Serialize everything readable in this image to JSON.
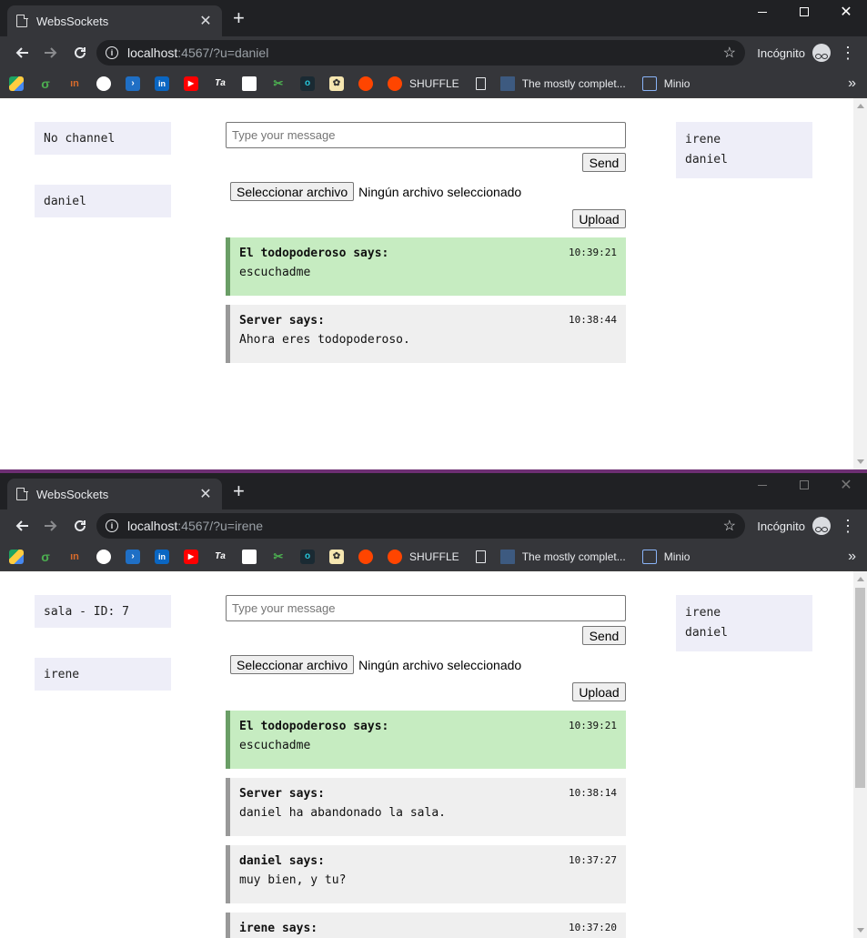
{
  "browser": {
    "tab_title": "WebsSockets",
    "tab_close": "✕",
    "new_tab": "+",
    "incognito_label": "Incógnito",
    "bookmarks_more": "»",
    "bookmarks": {
      "shuffle": "SHUFFLE",
      "mostly": "The mostly complet...",
      "minio": "Minio"
    },
    "icons": [
      "google-drive-icon",
      "sigma-icon",
      "mendeley-icon",
      "github-icon",
      "powershell-icon",
      "linkedin-icon",
      "youtube-icon",
      "tg-icon",
      "circle-app-icon",
      "link-icon",
      "teal-app-icon",
      "badge-icon",
      "reddit-icon",
      "reddit-icon",
      "doc-icon",
      "page-thumb-icon",
      "laptop-icon"
    ]
  },
  "top": {
    "url_host": "localhost",
    "url_rest": ":4567/?u=daniel",
    "channel": "No channel",
    "username": "daniel",
    "input_placeholder": "Type your message",
    "send_label": "Send",
    "file_button": "Seleccionar archivo",
    "file_status": "Ningún archivo seleccionado",
    "upload_label": "Upload",
    "users": [
      "irene",
      "daniel"
    ],
    "messages": [
      {
        "author": "El todopoderoso says:",
        "time": "10:39:21",
        "text": "escuchadme",
        "highlight": true
      },
      {
        "author": "Server says:",
        "time": "10:38:44",
        "text": "Ahora eres todopoderoso.",
        "highlight": false
      }
    ]
  },
  "bottom": {
    "url_host": "localhost",
    "url_rest": ":4567/?u=irene",
    "channel": "sala - ID: 7",
    "username": "irene",
    "input_placeholder": "Type your message",
    "send_label": "Send",
    "file_button": "Seleccionar archivo",
    "file_status": "Ningún archivo seleccionado",
    "upload_label": "Upload",
    "users": [
      "irene",
      "daniel"
    ],
    "messages": [
      {
        "author": "El todopoderoso says:",
        "time": "10:39:21",
        "text": "escuchadme",
        "highlight": true
      },
      {
        "author": "Server says:",
        "time": "10:38:14",
        "text": "daniel ha abandonado la sala.",
        "highlight": false
      },
      {
        "author": "daniel says:",
        "time": "10:37:27",
        "text": "muy bien, y tu?",
        "highlight": false
      },
      {
        "author": "irene says:",
        "time": "10:37:20",
        "text": "",
        "highlight": false
      }
    ]
  },
  "colors": {
    "highlight_bg": "#c6ecc1",
    "highlight_border": "#6a9e66",
    "message_bg": "#efefef",
    "side_box_bg": "#eeeef8"
  }
}
